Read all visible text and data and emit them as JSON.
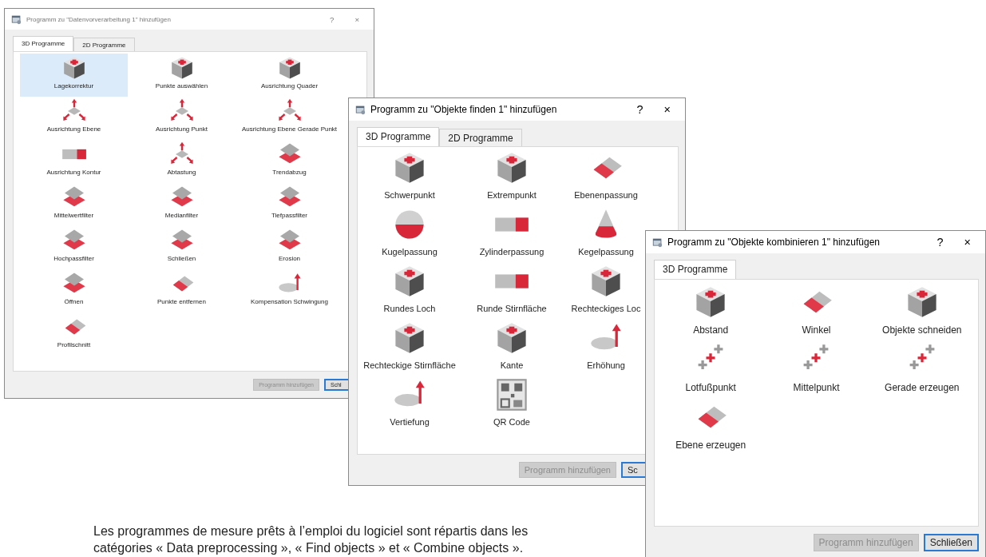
{
  "windows": [
    {
      "title": "Programm zu \"Datenvorverarbeitung 1\" hinzufügen",
      "help": "?",
      "close": "×",
      "tabs": [
        {
          "label": "3D Programme",
          "selected": true
        },
        {
          "label": "2D Programme",
          "selected": false
        }
      ],
      "items": [
        {
          "label": "Lagekorrektur",
          "selected": true
        },
        {
          "label": "Punkte auswählen",
          "selected": false
        },
        {
          "label": "Ausrichtung Quader",
          "selected": false
        },
        {
          "label": "Ausrichtung Ebene",
          "selected": false
        },
        {
          "label": "Ausrichtung Punkt",
          "selected": false
        },
        {
          "label": "Ausrichtung Ebene Gerade Punkt",
          "selected": false
        },
        {
          "label": "Ausrichtung Kontur",
          "selected": false
        },
        {
          "label": "Abtastung",
          "selected": false
        },
        {
          "label": "Trendabzug",
          "selected": false
        },
        {
          "label": "Mittelwertfilter",
          "selected": false
        },
        {
          "label": "Medianfilter",
          "selected": false
        },
        {
          "label": "Tiefpassfilter",
          "selected": false
        },
        {
          "label": "Hochpassfilter",
          "selected": false
        },
        {
          "label": "Schließen",
          "selected": false
        },
        {
          "label": "Erosion",
          "selected": false
        },
        {
          "label": "Öffnen",
          "selected": false
        },
        {
          "label": "Punkte entfernen",
          "selected": false
        },
        {
          "label": "Kompensation Schwingung",
          "selected": false
        },
        {
          "label": "Profilschnitt",
          "selected": false
        }
      ],
      "buttons": [
        {
          "label": "Programm hinzufügen",
          "disabled": true
        },
        {
          "label": "Schl",
          "disabled": false
        }
      ]
    },
    {
      "title": "Programm zu \"Objekte finden 1\" hinzufügen",
      "help": "?",
      "close": "×",
      "tabs": [
        {
          "label": "3D Programme",
          "selected": true
        },
        {
          "label": "2D Programme",
          "selected": false
        }
      ],
      "items": [
        {
          "label": "Schwerpunkt",
          "selected": false
        },
        {
          "label": "Extrempunkt",
          "selected": false
        },
        {
          "label": "Ebenenpassung",
          "selected": false
        },
        {
          "label": "Kugelpassung",
          "selected": false
        },
        {
          "label": "Zylinderpassung",
          "selected": false
        },
        {
          "label": "Kegelpassung",
          "selected": false
        },
        {
          "label": "Rundes Loch",
          "selected": false
        },
        {
          "label": "Runde Stirnfläche",
          "selected": false
        },
        {
          "label": "Rechteckiges Loc",
          "selected": false
        },
        {
          "label": "Rechteckige Stirnfläche",
          "selected": false
        },
        {
          "label": "Kante",
          "selected": false
        },
        {
          "label": "Erhöhung",
          "selected": false
        },
        {
          "label": "Vertiefung",
          "selected": false
        },
        {
          "label": "QR Code",
          "selected": false
        }
      ],
      "buttons": [
        {
          "label": "Programm hinzufügen",
          "disabled": true
        },
        {
          "label": "Sc",
          "disabled": false
        }
      ]
    },
    {
      "title": "Programm zu \"Objekte kombinieren 1\" hinzufügen",
      "help": "?",
      "close": "×",
      "tabs": [
        {
          "label": "3D Programme",
          "selected": true
        }
      ],
      "items": [
        {
          "label": "Abstand",
          "selected": false
        },
        {
          "label": "Winkel",
          "selected": false
        },
        {
          "label": "Objekte schneiden",
          "selected": false
        },
        {
          "label": "Lotfußpunkt",
          "selected": false
        },
        {
          "label": "Mittelpunkt",
          "selected": false
        },
        {
          "label": "Gerade erzeugen",
          "selected": false
        },
        {
          "label": "Ebene erzeugen",
          "selected": false
        }
      ],
      "buttons": [
        {
          "label": "Programm hinzufügen",
          "disabled": true
        },
        {
          "label": "Schließen",
          "disabled": false
        }
      ]
    }
  ],
  "caption": "Les programmes de mesure prêts à l’emploi du logiciel sont répartis dans les catégories « Data preprocessing », « Find objects » et « Combine objects »."
}
